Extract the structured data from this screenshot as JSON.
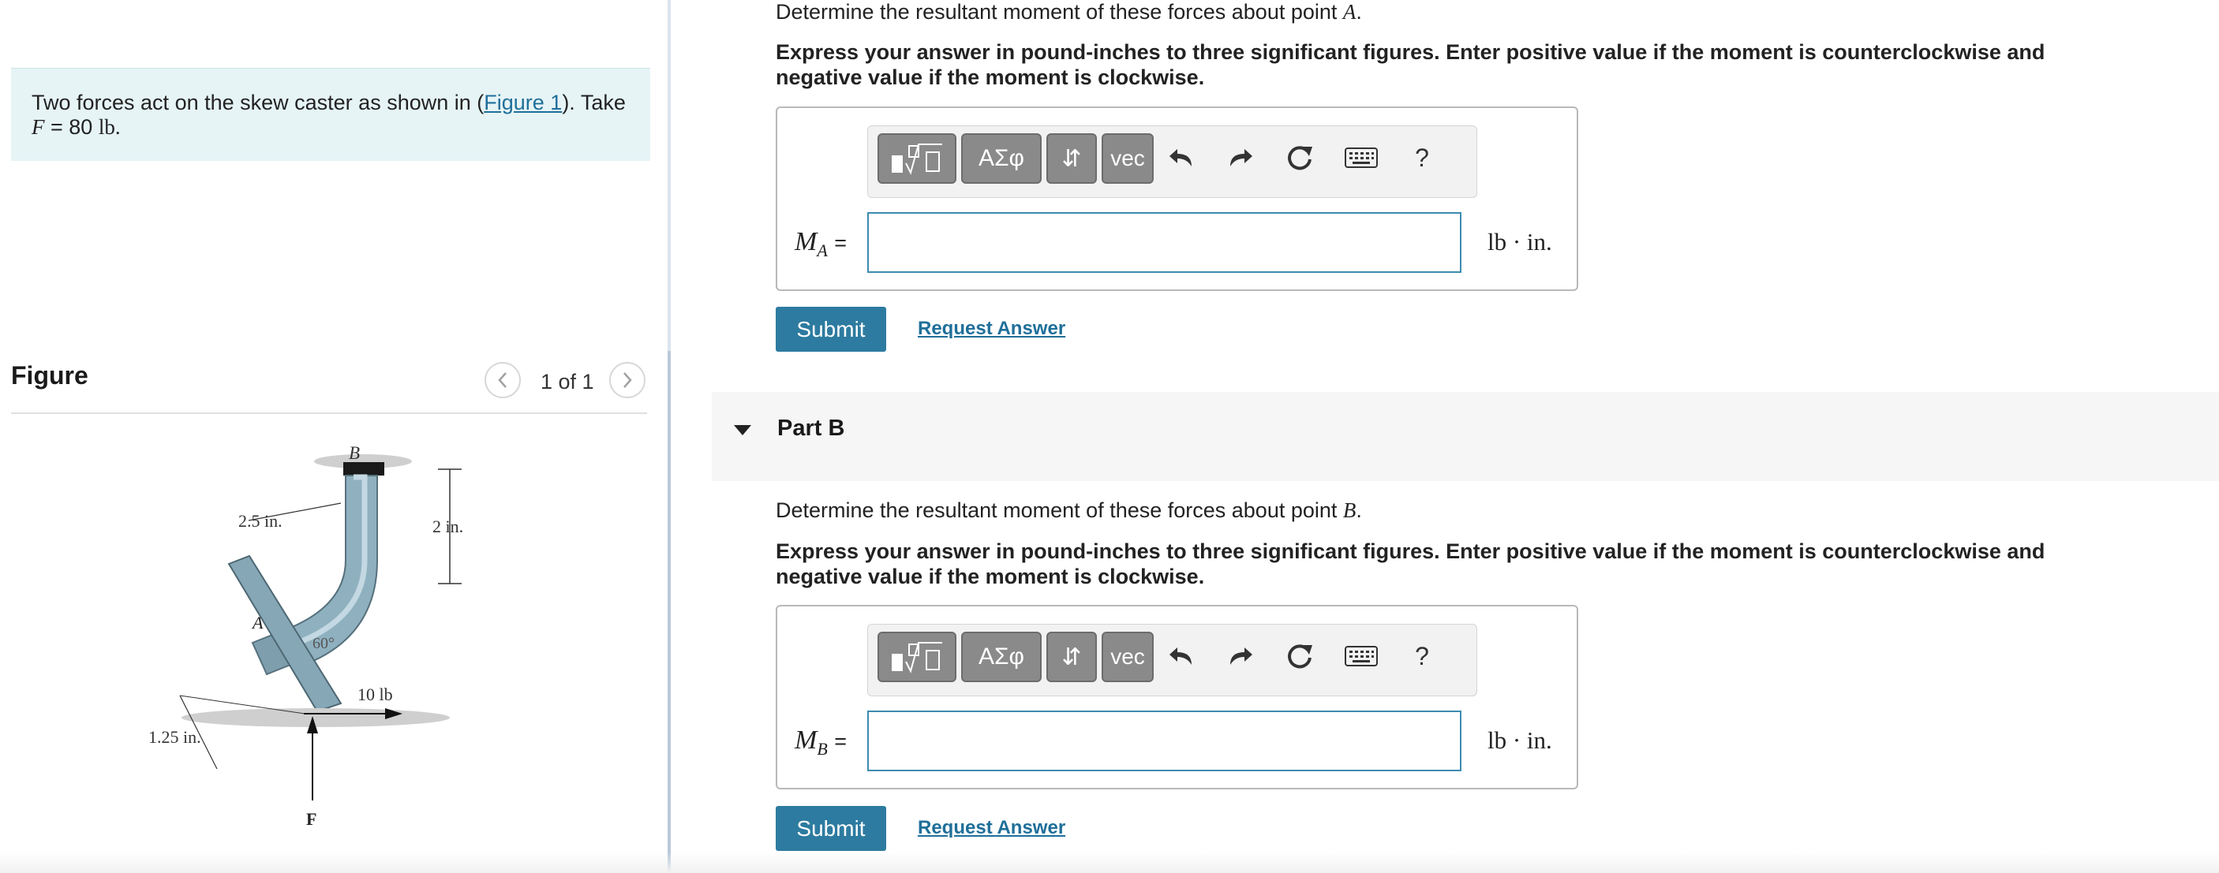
{
  "problem": {
    "text_before": "Two forces act on the skew caster as shown in (",
    "figure_link": "Figure 1",
    "text_after": "). Take",
    "var_f": "F",
    "equals": " = 80 ",
    "unit": "lb."
  },
  "figure": {
    "title": "Figure",
    "prev_icon": "chevron-left-icon",
    "next_icon": "chevron-right-icon",
    "page_count": "1 of 1",
    "labels": {
      "b": "B",
      "a": "A",
      "dim_2_5": "2.5 in.",
      "dim_2": "2 in.",
      "angle": "60°",
      "force_10": "10 lb",
      "dim_1_25": "1.25 in.",
      "force_f": "F"
    }
  },
  "partA": {
    "question_prefix": "Determine the resultant moment of these forces about point ",
    "question_point": "A",
    "question_suffix": ".",
    "instruction": "Express your answer in pound-inches to three significant figures. Enter positive value if the moment is counterclockwise and negative value if the moment is clockwise.",
    "var": "M",
    "var_sub": "A",
    "equals": "=",
    "input_value": "",
    "unit": "lb · in.",
    "submit": "Submit",
    "request": "Request Answer"
  },
  "partB": {
    "title": "Part B",
    "question_prefix": "Determine the resultant moment of these forces about point ",
    "question_point": "B",
    "question_suffix": ".",
    "instruction": "Express your answer in pound-inches to three significant figures. Enter positive value if the moment is counterclockwise and negative value if the moment is clockwise.",
    "var": "M",
    "var_sub": "B",
    "equals": "=",
    "input_value": "",
    "unit": "lb · in.",
    "submit": "Submit",
    "request": "Request Answer"
  },
  "toolbar": {
    "greek": "ΑΣφ",
    "arrows": "⇵",
    "vec": "vec",
    "help": "?",
    "icons": [
      "templates-icon",
      "undo-icon",
      "redo-icon",
      "reset-icon",
      "keyboard-icon"
    ]
  },
  "colors": {
    "accent": "#2d7ba0",
    "link": "#1f6f9a",
    "problem_bg": "#e6f4f6",
    "toolbar_btn": "#8a8a8a"
  }
}
